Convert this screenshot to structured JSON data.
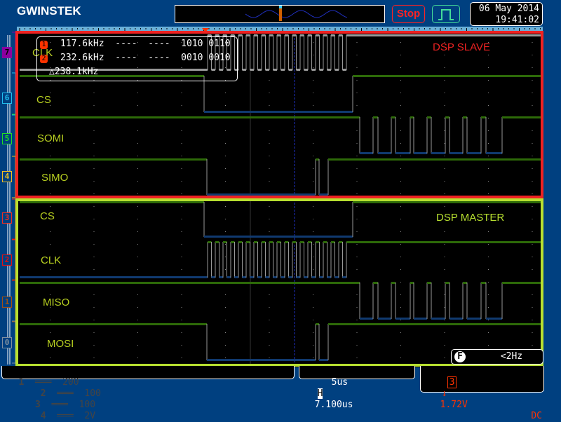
{
  "header": {
    "logo": "GWINSTEK",
    "run_state": "Stop",
    "date": "06 May 2014",
    "time": "19:41:02",
    "trigger_mode_icon": "pulse-icon"
  },
  "groups": [
    {
      "label": "DSP SLAVE",
      "color": "#ee2222"
    },
    {
      "label": "DSP MASTER",
      "color": "#b8e030"
    }
  ],
  "channels": [
    {
      "num": "7",
      "label": "CLK",
      "color": "#8a00a0"
    },
    {
      "num": "6",
      "label": "CS",
      "color": "#20c0f0"
    },
    {
      "num": "5",
      "label": "SOMI",
      "color": "#20e020"
    },
    {
      "num": "4",
      "label": "SIMO",
      "color": "#f0c020"
    },
    {
      "num": "3",
      "label": "CS",
      "color": "#f03020"
    },
    {
      "num": "2",
      "label": "CLK",
      "color": "#e01010"
    },
    {
      "num": "1",
      "label": "MISO",
      "color": "#a05010"
    },
    {
      "num": "0",
      "label": "MOSI",
      "color": "#8090a0"
    }
  ],
  "cursors": {
    "c1": "1",
    "c2": "2",
    "c1_readout": "117.6kHz  ----  ----  1010 0110",
    "c2_readout": "232.6kHz  ----  ----  0010 0010",
    "delta": "△238.1kHz"
  },
  "analog": [
    {
      "num": "1",
      "scale": "200"
    },
    {
      "num": "2",
      "scale": "100"
    },
    {
      "num": "3",
      "scale": "100"
    },
    {
      "num": "4",
      "scale": "2V"
    }
  ],
  "timebase": {
    "scale": "5us",
    "position_label": "H",
    "position": "7.100us"
  },
  "trigger": {
    "source": "3",
    "slope": "↓",
    "level": "1.72V",
    "coupling": "DC"
  },
  "frequency": {
    "label": "F",
    "value": "<2Hz"
  }
}
